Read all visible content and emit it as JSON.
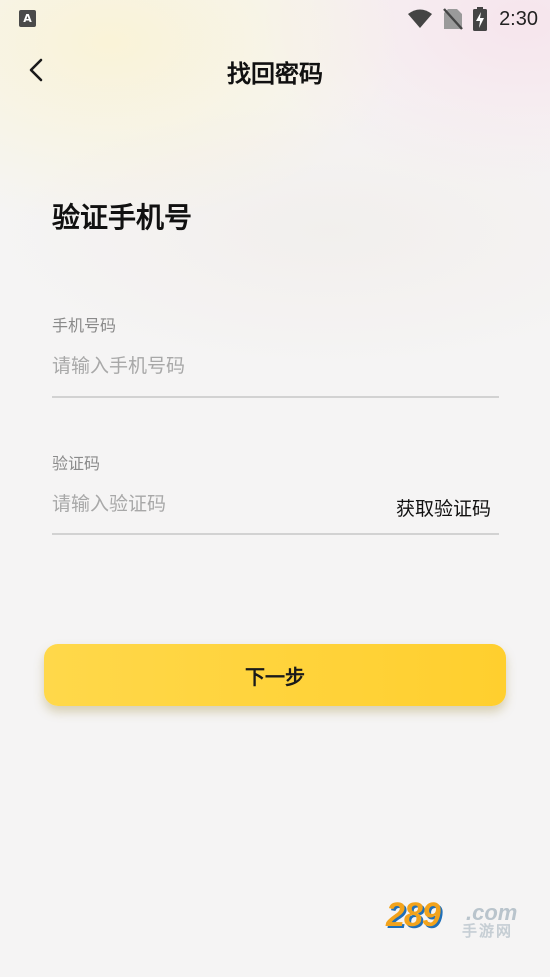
{
  "status_bar": {
    "app_icon_letter": "A",
    "time": "2:30"
  },
  "header": {
    "title": "找回密码"
  },
  "form": {
    "heading": "验证手机号",
    "phone_label": "手机号码",
    "phone_placeholder": "请输入手机号码",
    "phone_value": "",
    "code_label": "验证码",
    "code_placeholder": "请输入验证码",
    "code_value": "",
    "get_code_label": "获取验证码"
  },
  "actions": {
    "next_label": "下一步",
    "accent_color": "#ffd23c"
  },
  "watermark": {
    "number": "289",
    "domain": ".com",
    "subtitle": "手游网"
  },
  "icons": {
    "status": [
      "wifi-icon",
      "no-sim-icon",
      "battery-charging-icon"
    ],
    "header": "back-arrow-icon"
  }
}
